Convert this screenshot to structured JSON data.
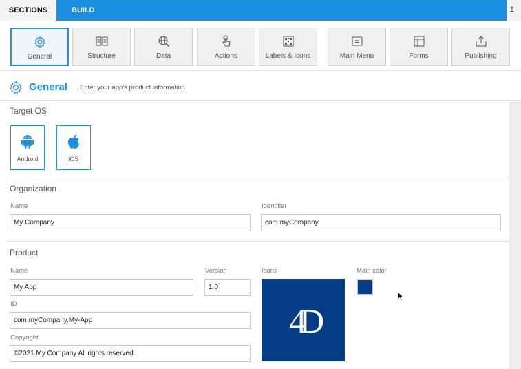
{
  "tabs": {
    "sections": "SECTIONS",
    "build": "BUILD"
  },
  "export_icon": "↥",
  "toolbar": [
    {
      "label": "General",
      "icon": "gear-icon",
      "active": true
    },
    {
      "label": "Structure",
      "icon": "structure-icon",
      "active": false
    },
    {
      "label": "Data",
      "icon": "database-icon",
      "active": false
    },
    {
      "label": "Actions",
      "icon": "hand-pointer-icon",
      "active": false
    },
    {
      "label": "Labels & Icons",
      "icon": "qr-grid-icon",
      "active": false
    },
    {
      "label": "Main Menu",
      "icon": "menu-icon",
      "active": false
    },
    {
      "label": "Forms",
      "icon": "form-icon",
      "active": false
    },
    {
      "label": "Publishing",
      "icon": "upload-icon",
      "active": false
    }
  ],
  "header": {
    "title": "General",
    "subtitle": "Enter your app's product information"
  },
  "target_os": {
    "title": "Target OS",
    "android": "Android",
    "ios": "iOS"
  },
  "organization": {
    "title": "Organization",
    "name_label": "Name",
    "name_value": "My Company",
    "identifier_label": "Identifier",
    "identifier_value": "com.myCompany"
  },
  "product": {
    "title": "Product",
    "name_label": "Name",
    "name_value": "My App",
    "version_label": "Version",
    "version_value": "1.0",
    "icons_label": "Icons",
    "main_color_label": "Main color",
    "main_color": "#063b86",
    "id_label": "ID",
    "id_value": "com.myCompany.My-App",
    "copyright_label": "Copyright",
    "copyright_value": "©2021 My Company All rights reserved",
    "logo_text": "4D"
  },
  "colors": {
    "accent": "#1a8fe0",
    "brand": "#063b86"
  }
}
